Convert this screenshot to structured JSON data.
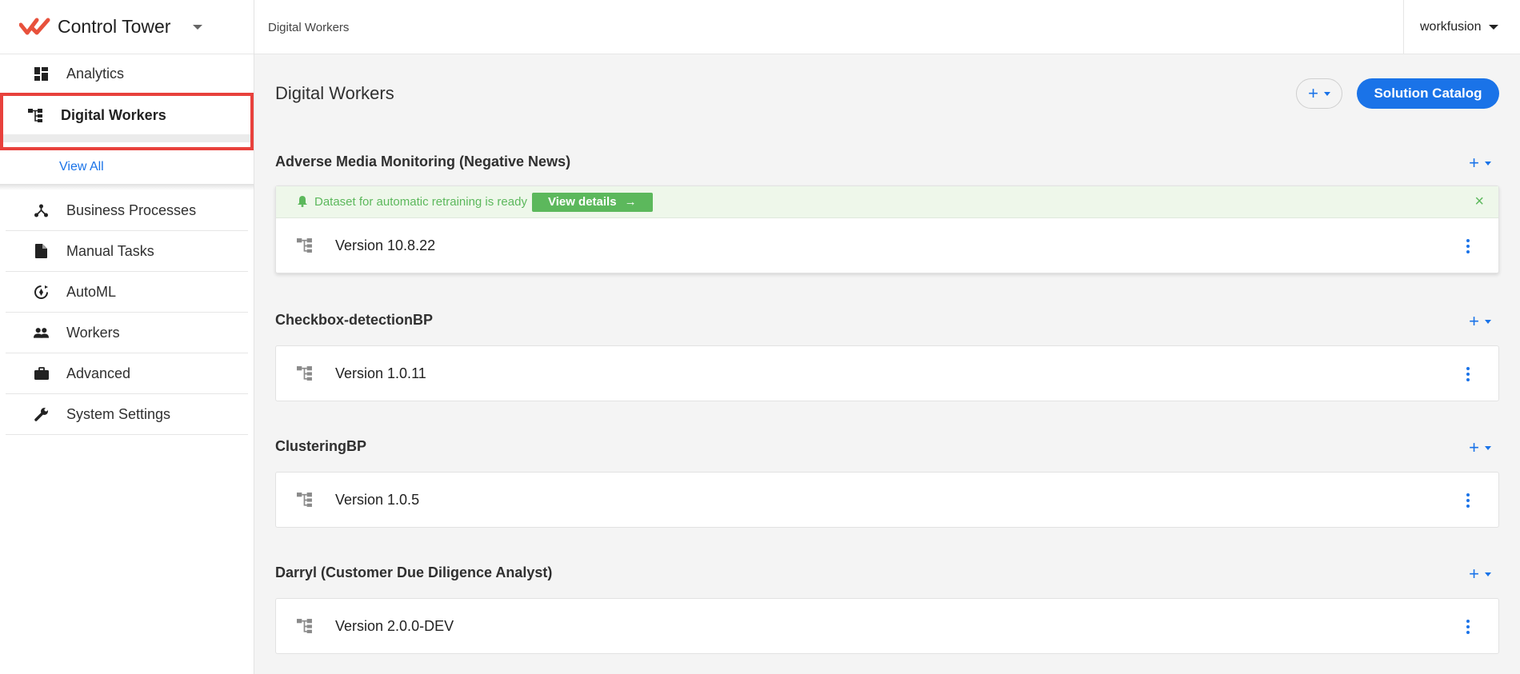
{
  "app": {
    "title": "Control Tower"
  },
  "sidebar": {
    "items": [
      {
        "label": "Analytics",
        "icon": "dashboard-icon"
      },
      {
        "label": "Digital Workers",
        "icon": "hierarchy-icon",
        "active": true
      },
      {
        "label": "Business Processes",
        "icon": "process-icon"
      },
      {
        "label": "Manual Tasks",
        "icon": "document-icon"
      },
      {
        "label": "AutoML",
        "icon": "automl-icon"
      },
      {
        "label": "Workers",
        "icon": "people-icon"
      },
      {
        "label": "Advanced",
        "icon": "briefcase-icon"
      },
      {
        "label": "System Settings",
        "icon": "wrench-icon"
      }
    ],
    "sub_view_all": "View All"
  },
  "header": {
    "breadcrumb": "Digital Workers",
    "user": "workfusion"
  },
  "main": {
    "title": "Digital Workers",
    "add_symbol": "+",
    "catalog_button": "Solution Catalog",
    "sections": [
      {
        "title": "Adverse Media Monitoring (Negative News)",
        "alert": {
          "message": "Dataset for automatic retraining is ready",
          "action": "View details",
          "arrow": "→",
          "close": "×"
        },
        "version": "Version 10.8.22"
      },
      {
        "title": "Checkbox-detectionBP",
        "version": "Version 1.0.11"
      },
      {
        "title": "ClusteringBP",
        "version": "Version 1.0.5"
      },
      {
        "title": "Darryl (Customer Due Diligence Analyst)",
        "version": "Version 2.0.0-DEV"
      }
    ]
  },
  "colors": {
    "accent": "#1a73e8",
    "brand": "#e8513c",
    "success": "#5cb85c",
    "highlight": "#e8413c"
  }
}
